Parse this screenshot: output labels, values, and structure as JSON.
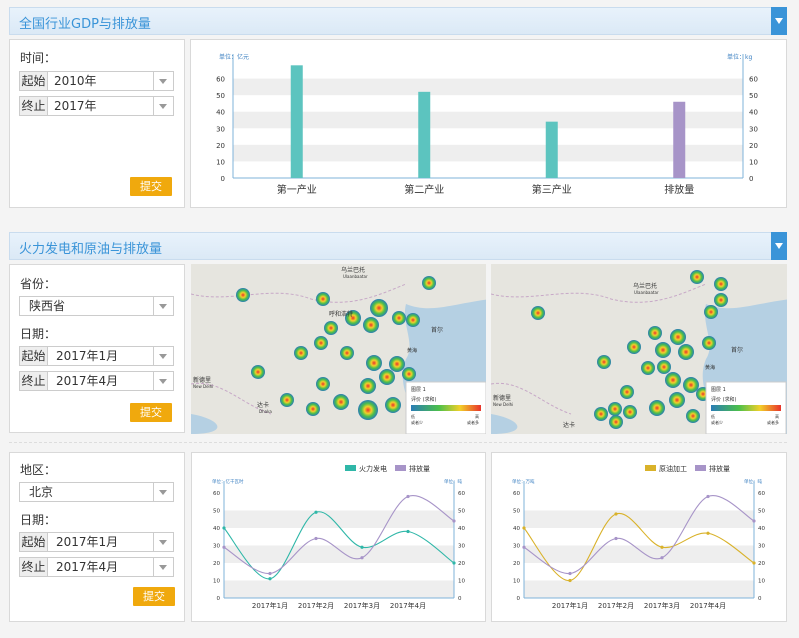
{
  "section1": {
    "title": "全国行业GDP与排放量",
    "time_label": "时间：",
    "start_prefix": "起始",
    "start_value": "2010年",
    "end_prefix": "终止",
    "end_value": "2017年",
    "submit": "提交"
  },
  "section2": {
    "title": "火力发电和原油与排放量",
    "province_label": "省份：",
    "province_value": "陕西省",
    "date_label": "日期：",
    "start_prefix": "起始",
    "start_value": "2017年1月",
    "end_prefix": "终止",
    "end_value": "2017年4月",
    "submit": "提交",
    "region_label": "地区：",
    "region_value": "北京",
    "date_label2": "日期：",
    "start_value2": "2017年1月",
    "end_value2": "2017年4月",
    "submit2": "提交"
  },
  "maps": {
    "labels_left": [
      "乌兰巴托",
      "Ulaanbaatar",
      "呼和浩特",
      "首尔",
      "黄海",
      "新德里",
      "New Delhi",
      "达卡",
      "Dhaka"
    ],
    "labels_right": [
      "乌兰巴托",
      "Ulaanbaatar",
      "首尔",
      "黄海",
      "新德里",
      "New Delhi",
      "达卡"
    ],
    "legend_title": "图层 1",
    "legend_subtitle": "评价 (求和)",
    "legend_low": "低",
    "legend_high": "高",
    "legend_low_text": "或者少",
    "legend_high_text": "或者多"
  },
  "colors": {
    "teal": "#5cc4bf",
    "purple": "#a794c8",
    "yellow": "#d9b22a",
    "accent": "#3a94d8",
    "button": "#f0a90d"
  },
  "chart_data": [
    {
      "type": "bar",
      "title": "",
      "left_unit": "单位：亿元",
      "right_unit": "单位：kg",
      "categories": [
        "第一产业",
        "第二产业",
        "第三产业",
        "排放量"
      ],
      "values": [
        68,
        52,
        34,
        46
      ],
      "bar_colors": [
        "#5cc4bf",
        "#5cc4bf",
        "#5cc4bf",
        "#a794c8"
      ],
      "ylim": [
        0,
        70
      ],
      "yticks": [
        0,
        10,
        20,
        30,
        40,
        50,
        60
      ],
      "grid": true
    },
    {
      "type": "line",
      "left_unit": "单位：亿千瓦时",
      "right_unit": "单位：吨",
      "x": [
        "2017年1月",
        "2017年2月",
        "2017年3月",
        "2017年4月"
      ],
      "series": [
        {
          "name": "火力发电",
          "color": "#2fb7a8",
          "values": [
            40,
            11,
            49,
            29,
            38,
            20
          ]
        },
        {
          "name": "排放量",
          "color": "#a794c8",
          "values": [
            29,
            14,
            34,
            23,
            58,
            44
          ]
        }
      ],
      "ylim": [
        0,
        60
      ],
      "yticks": [
        0,
        10,
        20,
        30,
        40,
        50,
        60
      ],
      "grid": true
    },
    {
      "type": "line",
      "left_unit": "单位：万吨",
      "right_unit": "单位：吨",
      "x": [
        "2017年1月",
        "2017年2月",
        "2017年3月",
        "2017年4月"
      ],
      "series": [
        {
          "name": "原油加工",
          "color": "#d9b22a",
          "values": [
            40,
            10,
            48,
            29,
            37,
            20
          ]
        },
        {
          "name": "排放量",
          "color": "#a794c8",
          "values": [
            29,
            14,
            34,
            23,
            58,
            44
          ]
        }
      ],
      "ylim": [
        0,
        60
      ],
      "yticks": [
        0,
        10,
        20,
        30,
        40,
        50,
        60
      ],
      "grid": true
    }
  ]
}
